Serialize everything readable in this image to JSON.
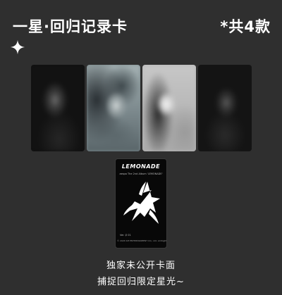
{
  "header": {
    "title": "一星·回归记录卡",
    "count": "*共4款"
  },
  "icons": {
    "sparkle": "sparkle-icon"
  },
  "cards": [
    {
      "kind": "blurred-photo",
      "tone": "dark"
    },
    {
      "kind": "blurred-photo",
      "tone": "blue-grey"
    },
    {
      "kind": "blurred-photo",
      "tone": "light-grey"
    },
    {
      "kind": "blurred-photo",
      "tone": "dark"
    }
  ],
  "album_card": {
    "title": "LEMONADE",
    "subtitle": "aespa The 2nd Album 'LEMONADE'",
    "version": "Ver. ♀ 01",
    "copyright": "© 2026 SM ENTERTAINMENT CO., Ltd. All Rights Reserved."
  },
  "captions": {
    "line1": "独家未公开卡面",
    "line2": "捕捉回归限定星光~"
  },
  "colors": {
    "background": "#2f2f2f",
    "text": "#ffffff",
    "album_card_bg": "#080808"
  }
}
